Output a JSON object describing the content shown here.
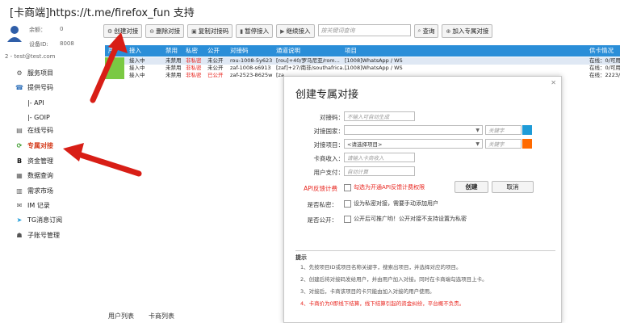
{
  "title": "[卡商端]https://t.me/firefox_fun 支持",
  "sidebar": {
    "balance_label": "余额：",
    "balance_value": "0",
    "device_label": "设备ID:",
    "device_value": "8008",
    "email": "2 - test@test.com",
    "items": [
      {
        "label": "服务项目",
        "icon": "gear-icon"
      },
      {
        "label": "提供号码",
        "icon": "phone-icon"
      },
      {
        "label": "|- API",
        "icon": ""
      },
      {
        "label": "|- GOIP",
        "icon": ""
      },
      {
        "label": "在线号码",
        "icon": "list-icon"
      },
      {
        "label": "专属对接",
        "icon": "link-icon"
      },
      {
        "label": "资金管理",
        "icon": "bold-b-icon"
      },
      {
        "label": "数据查询",
        "icon": "grid-icon"
      },
      {
        "label": "需求市场",
        "icon": "chart-icon"
      },
      {
        "label": "IM 记录",
        "icon": "chat-icon"
      },
      {
        "label": "TG消息订阅",
        "icon": "telegram-icon"
      },
      {
        "label": "子账号管理",
        "icon": "users-icon"
      }
    ]
  },
  "toolbar": {
    "create": "创建对接",
    "delete": "删除对接",
    "copy": "复制对接码",
    "pause": "暂停接入",
    "resume": "继续接入",
    "search_placeholder": "按关键词查询",
    "query": "查询",
    "join": "加入专属对接"
  },
  "table": {
    "headers": [
      "序",
      "接入",
      "禁用",
      "私密",
      "公开",
      "对接码",
      "通道说明",
      "项目",
      "供卡情况"
    ],
    "rows": [
      {
        "status": "接入中",
        "disabled": "未禁用",
        "private": "非私密",
        "public": "未公开",
        "code": "rou-1008-5y623",
        "channel": "[rou]+40/罗马尼亚/rom...",
        "project": "[1008]WhatsApp / WS",
        "supply": "在线：0/可用"
      },
      {
        "status": "接入中",
        "disabled": "未禁用",
        "private": "非私密",
        "public": "未公开",
        "code": "zaf-1008-s6913",
        "channel": "[zaf]+27/南非/southafrica...",
        "project": "[1008]WhatsApp / WS",
        "supply": "在线：0/可用"
      },
      {
        "status": "接入中",
        "disabled": "未禁用",
        "private": "非私密",
        "public": "已公开",
        "code": "zaf-2523-8625w",
        "channel": "[za",
        "project": "",
        "supply": "在线：2223/"
      }
    ]
  },
  "footer_tabs": [
    "用户列表",
    "卡商列表"
  ],
  "modal": {
    "title": "创建专属对接",
    "code_label": "对接码：",
    "code_placeholder": "不输入可自动生成",
    "country_label": "对接国家：",
    "country_keyword": "关键字",
    "project_label": "对接项目：",
    "project_value": "<请选择项目>",
    "project_keyword": "关键字",
    "income_label": "卡商收入：",
    "income_placeholder": "请输入卡商收入",
    "pay_label": "用户支付：",
    "pay_placeholder": "自动计算",
    "api_label": "API反馈计费",
    "api_check": "勾选为开通API反馈计费权限",
    "private_label": "是否私密：",
    "private_check": "设为私密对接，需要手动添加用户",
    "public_label": "是否公开：",
    "public_check": "公开后可推广哟！公开对接不支持设置为私密",
    "create_btn": "创建",
    "cancel_btn": "取消",
    "tips_title": "提示",
    "tips": [
      "1、先按项目ID或项目名称关键字，搜索出项目，并选择对应的项目。",
      "2、创建后将对接码发给用户，并由用户加入对接。同时在卡商端勾选项目上卡。",
      "3、对接后，卡商该项目的卡只能由加入对接的用户使用。",
      "4、卡商价为0即线下结算，线下结算引起的资金纠纷，平台概不负责。"
    ]
  },
  "colors": {
    "header_blue": "#2a8ed8",
    "accent_red": "#e8231c",
    "arrow_red": "#d81e16",
    "picker": "#1e9bd7",
    "picker2": "#ff6a00"
  }
}
